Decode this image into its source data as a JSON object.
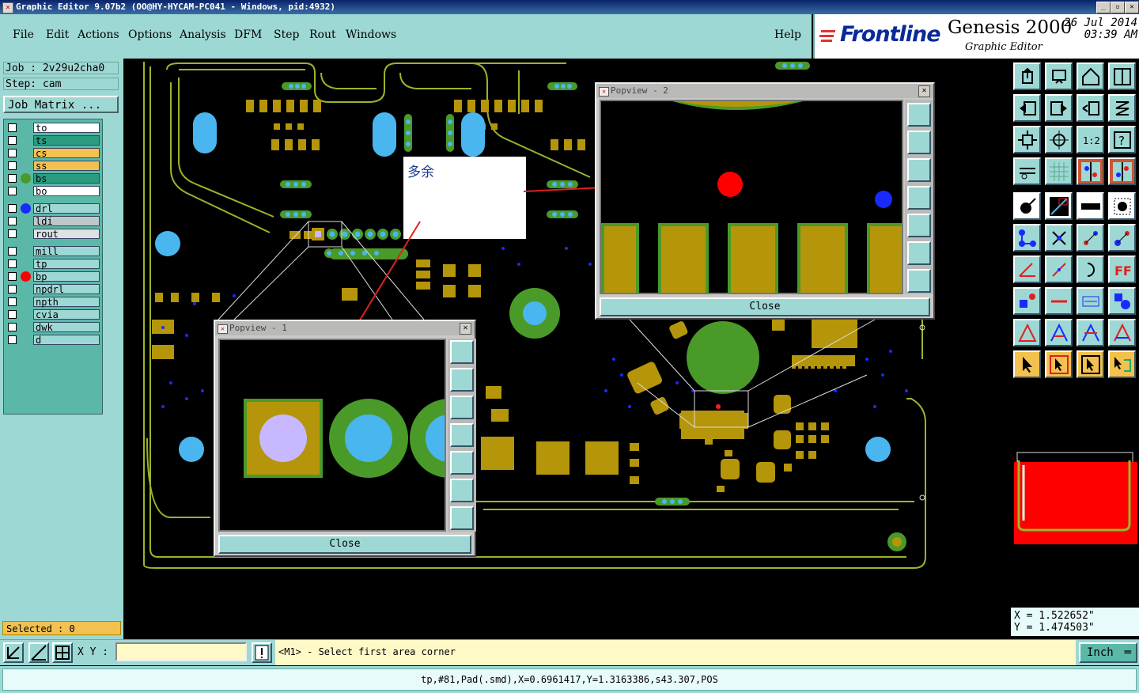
{
  "window": {
    "title": "Graphic Editor 9.07b2 (OO@HY-HYCAM-PC041 - Windows, pid:4932)"
  },
  "menu": [
    "File",
    "Edit",
    "Actions",
    "Options",
    "Analysis",
    "DFM",
    "Step",
    "Rout",
    "Windows"
  ],
  "help_label": "Help",
  "brand": {
    "logo": "Frontline",
    "product": "Genesis 2000",
    "subtitle": "Graphic Editor",
    "date": "26 Jul 2014",
    "time": "03:39 AM"
  },
  "job": {
    "job_label": "Job : 2v29u2cha0",
    "step_label": "Step: cam",
    "matrix_button": "Job Matrix ..."
  },
  "layers": [
    {
      "name": "to",
      "color": "#ffffff",
      "dot": ""
    },
    {
      "name": "ts",
      "color": "#2a9d80",
      "dot": ""
    },
    {
      "name": "cs",
      "color": "#f2c14f",
      "dot": ""
    },
    {
      "name": "ss",
      "color": "#f2c14f",
      "dot": ""
    },
    {
      "name": "bs",
      "color": "#2a9d80",
      "dot": "#4a9a2a"
    },
    {
      "name": "bo",
      "color": "#ffffff",
      "dot": ""
    },
    {
      "name": "drl",
      "color": "#9ed8d4",
      "dot": "#1a2aff"
    },
    {
      "name": "ldi",
      "color": "#bfc7c7",
      "dot": ""
    },
    {
      "name": "rout",
      "color": "#dde3e3",
      "dot": ""
    },
    {
      "name": "mill",
      "color": "#9ed8d4",
      "dot": ""
    },
    {
      "name": "tp",
      "color": "#9ed8d4",
      "dot": ""
    },
    {
      "name": "bp",
      "color": "#9ed8d4",
      "dot": "#ff0000"
    },
    {
      "name": "npdrl",
      "color": "#9ed8d4",
      "dot": ""
    },
    {
      "name": "npth",
      "color": "#9ed8d4",
      "dot": ""
    },
    {
      "name": "cvia",
      "color": "#9ed8d4",
      "dot": ""
    },
    {
      "name": "dwk",
      "color": "#9ed8d4",
      "dot": ""
    },
    {
      "name": "d",
      "color": "#9ed8d4",
      "dot": ""
    }
  ],
  "selected": "Selected : 0",
  "popview1": {
    "title": "Popview - 1",
    "close_label": "Close"
  },
  "popview2": {
    "title": "Popview - 2",
    "close_label": "Close"
  },
  "note": {
    "text": "多余"
  },
  "coords": {
    "x": "X = 1.522652\"",
    "y": "Y = 1.474503\""
  },
  "bottom": {
    "xy_label": "X Y :",
    "xy_value": "",
    "prompt": "<M1> - Select first area corner",
    "unit": "Inch"
  },
  "status": "tp,#81,Pad(.smd),X=0.6961417,Y=1.3163386,s43.307,POS",
  "colors": {
    "panel": "#9ed8d4",
    "copper": "#b5950a",
    "soldermask": "#4a9a2a",
    "outline": "#9ab52a",
    "drill": "#4ab6f0"
  }
}
